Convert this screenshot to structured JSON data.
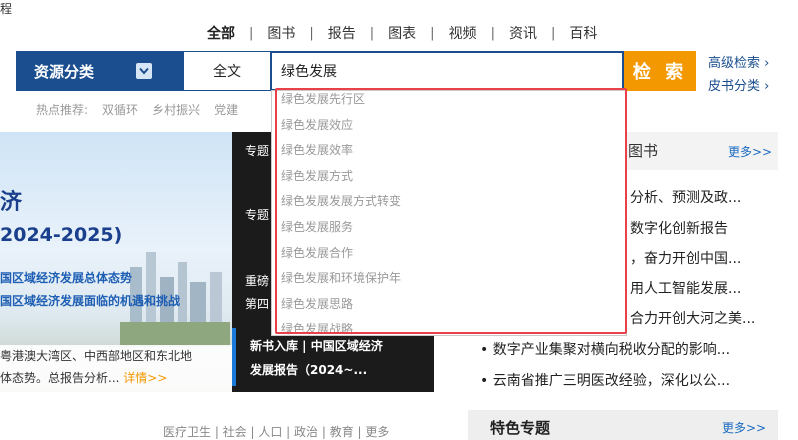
{
  "top": {
    "cut_text": "程",
    "tabs": [
      "全部",
      "图书",
      "报告",
      "图表",
      "视频",
      "资讯",
      "百科"
    ]
  },
  "search": {
    "category_label": "资源分类",
    "scope": "全文",
    "query": "绿色发展",
    "button": "检 索",
    "advanced": "高级检索 ›",
    "pishu": "皮书分类 ›"
  },
  "hot": {
    "label": "热点推荐:",
    "items": [
      "双循环",
      "乡村振兴",
      "党建"
    ]
  },
  "banner": {
    "t1": "济",
    "t2": "2024-2025)",
    "t3": "国区域经济发展总体态势",
    "t4": "国区域经济发展面临的机遇和挑战",
    "caption1": "粤港澳大湾区、中西部地区和东北地",
    "caption2": "体态势。总报告分析...",
    "more": "详情>>"
  },
  "side_menu": {
    "items": [
      "专题",
      "专题",
      "重磅",
      "第四"
    ],
    "new_book_1": "新书入库 | 中国区域经济",
    "new_book_2": "发展报告（2024~..."
  },
  "right": {
    "title_tail": "图书",
    "more": "更多>>",
    "news": [
      "分析、预测及政...",
      "数字化创新报告",
      "，奋力开创中国...",
      "用人工智能发展...",
      "合力开创大河之美...",
      "• 数字产业集聚对横向税收分配的影响...",
      "• 云南省推广三明医改经验，深化以公..."
    ],
    "special_title": "特色专题",
    "special_more": "更多>>"
  },
  "bottom_links": "医疗卫生 | 社会 | 人口 | 政治 | 教育 | 更多",
  "suggestions": [
    "绿色发展先行区",
    "绿色发展效应",
    "绿色发展效率",
    "绿色发展方式",
    "绿色发展发展方式转变",
    "绿色发展服务",
    "绿色发展合作",
    "绿色发展和环境保护年",
    "绿色发展思路",
    "绿色发展战略"
  ],
  "colors": {
    "brand_blue": "#1a4e8e",
    "search_orange": "#f39800",
    "highlight_red": "#e8414a"
  }
}
